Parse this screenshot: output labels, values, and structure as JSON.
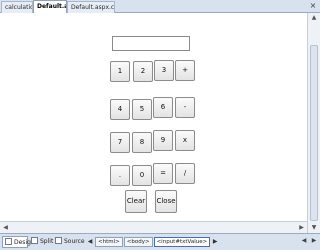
{
  "tabs": [
    {
      "label": "calculation"
    },
    {
      "label": "Default.aspx"
    },
    {
      "label": "Default.aspx.cs"
    }
  ],
  "window_close_glyph": "×",
  "textbox": {
    "value": ""
  },
  "keypad": {
    "row1": [
      "1",
      "2",
      "3",
      "+"
    ],
    "row2": [
      "4",
      "5",
      "6",
      "-"
    ],
    "row3": [
      "7",
      "8",
      "9",
      "x"
    ],
    "row4": [
      ".",
      "0",
      "=",
      "/"
    ]
  },
  "actions": {
    "clear": "Clear",
    "close": "Close"
  },
  "view_tabs": {
    "design": "Design",
    "split": "Split",
    "source": "Source"
  },
  "breadcrumbs": [
    "<html>",
    "<body>",
    "<input#txtValue>"
  ]
}
